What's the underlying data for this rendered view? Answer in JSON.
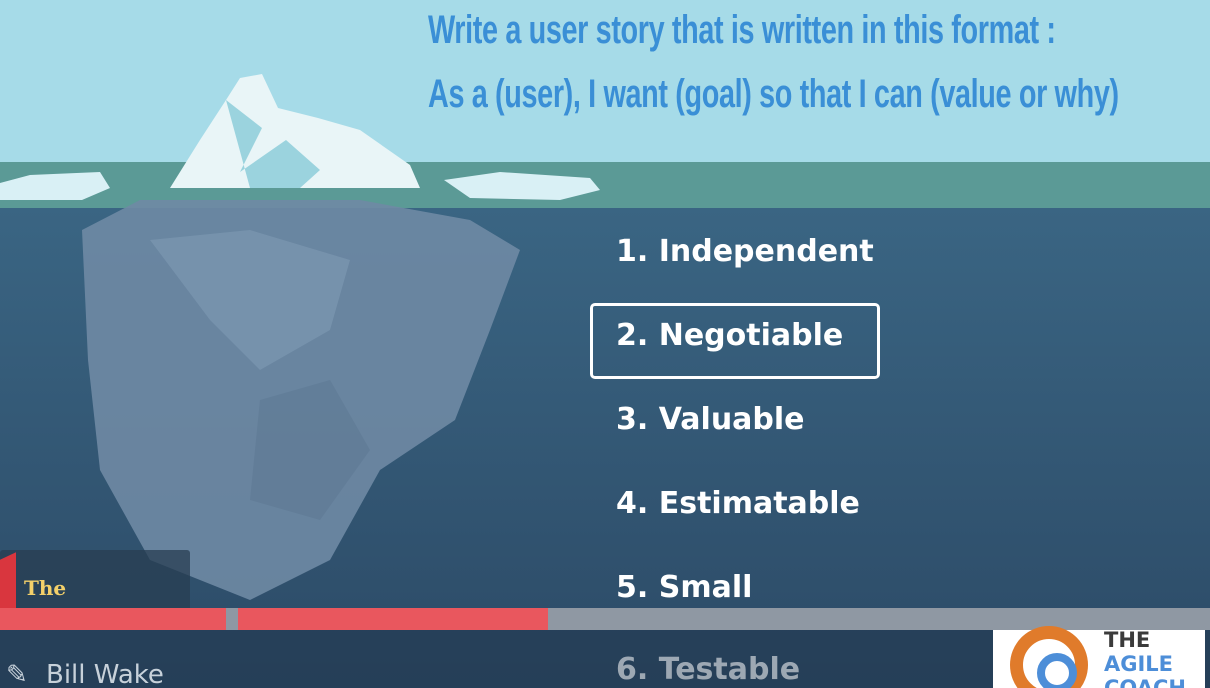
{
  "heading": {
    "line1": "Write a user story that is written in this format :",
    "line2": "As a (user), I want (goal) so that I can (value or why)"
  },
  "invest": {
    "items": [
      {
        "label": "1. Independent",
        "selected": false
      },
      {
        "label": "2. Negotiable",
        "selected": true
      },
      {
        "label": "3. Valuable",
        "selected": false
      },
      {
        "label": "4. Estimatable",
        "selected": false
      },
      {
        "label": "5. Small",
        "selected": false
      },
      {
        "label": "6. Testable",
        "selected": false
      }
    ]
  },
  "player": {
    "segments": [
      {
        "start": 0.0,
        "end": 0.187
      },
      {
        "start": 0.197,
        "end": 0.453
      }
    ]
  },
  "branding": {
    "left_logo_text": "The",
    "author": "Bill Wake",
    "right_logo_line1": "THE",
    "right_logo_line2": "AGILE",
    "right_logo_line3": "COACH"
  },
  "colors": {
    "heading": "#3a8fd6",
    "progress_played": "#e9575e",
    "progress_track": "#8f98a3"
  }
}
